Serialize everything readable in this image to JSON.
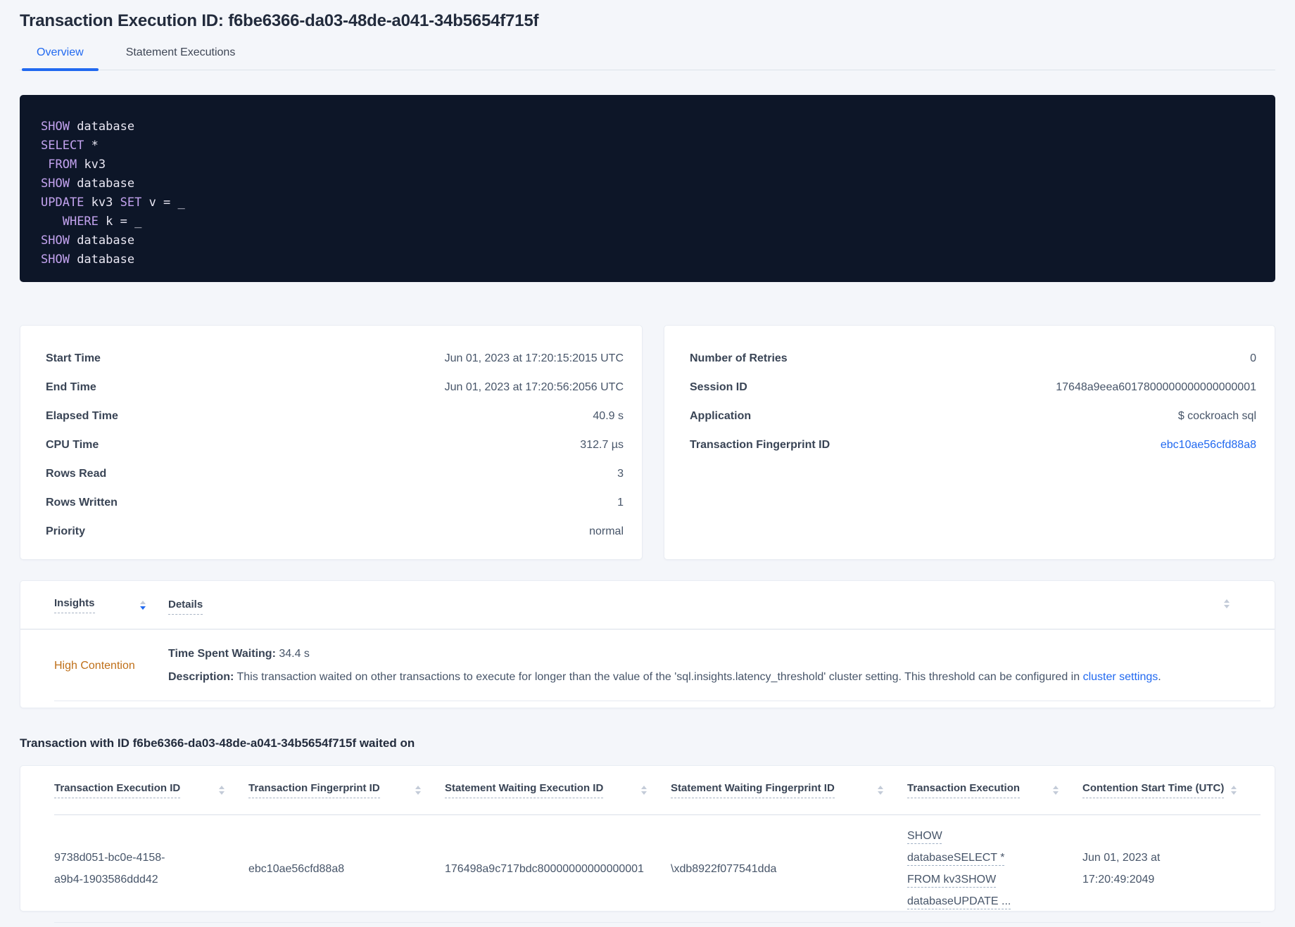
{
  "colors": {
    "accent_blue": "#2169f0",
    "high_contention_orange": "#bf6f18",
    "code_background": "#0d1628",
    "code_keyword": "#c2a2ee",
    "page_background": "#f4f6fa"
  },
  "icons": {
    "sort": "sort-arrows-icon (up/down triangles)"
  },
  "header": {
    "title": "Transaction Execution ID: f6be6366-da03-48de-a041-34b5654f715f",
    "tabs": [
      {
        "label": "Overview",
        "active": true
      },
      {
        "label": "Statement Executions",
        "active": false
      }
    ]
  },
  "sql_box": {
    "lines": [
      {
        "segments": [
          {
            "text": "SHOW",
            "kw": true
          },
          {
            "text": " database",
            "kw": false
          }
        ]
      },
      {
        "segments": [
          {
            "text": "SELECT",
            "kw": true
          },
          {
            "text": " *",
            "kw": false
          }
        ]
      },
      {
        "segments": [
          {
            "text": " ",
            "kw": false
          },
          {
            "text": "FROM",
            "kw": true
          },
          {
            "text": " kv3",
            "kw": false
          }
        ]
      },
      {
        "segments": [
          {
            "text": "SHOW",
            "kw": true
          },
          {
            "text": " database",
            "kw": false
          }
        ]
      },
      {
        "segments": [
          {
            "text": "UPDATE",
            "kw": true
          },
          {
            "text": " kv3 ",
            "kw": false
          },
          {
            "text": "SET",
            "kw": true
          },
          {
            "text": " v = _",
            "kw": false
          }
        ]
      },
      {
        "segments": [
          {
            "text": "   ",
            "kw": false
          },
          {
            "text": "WHERE",
            "kw": true
          },
          {
            "text": " k = _",
            "kw": false
          }
        ]
      },
      {
        "segments": [
          {
            "text": "SHOW",
            "kw": true
          },
          {
            "text": " database",
            "kw": false
          }
        ]
      },
      {
        "segments": [
          {
            "text": "SHOW",
            "kw": true
          },
          {
            "text": " database",
            "kw": false
          }
        ]
      }
    ]
  },
  "details_cards": {
    "left": {
      "rows": [
        {
          "label": "Start Time",
          "value": "Jun 01, 2023 at 17:20:15:2015 UTC"
        },
        {
          "label": "End Time",
          "value": "Jun 01, 2023 at 17:20:56:2056 UTC"
        },
        {
          "label": "Elapsed Time",
          "value": "40.9 s"
        },
        {
          "label": "CPU Time",
          "value": "312.7 µs"
        },
        {
          "label": "Rows Read",
          "value": "3"
        },
        {
          "label": "Rows Written",
          "value": "1"
        },
        {
          "label": "Priority",
          "value": "normal"
        }
      ]
    },
    "right": {
      "rows": [
        {
          "label": "Number of Retries",
          "value": "0"
        },
        {
          "label": "Session ID",
          "value": "17648a9eea6017800000000000000001"
        },
        {
          "label": "Application",
          "value": "$ cockroach sql"
        },
        {
          "label": "Transaction Fingerprint ID",
          "value": "ebc10ae56cfd88a8"
        }
      ]
    }
  },
  "insights_table": {
    "columns": [
      "Insights",
      "Details"
    ],
    "row": {
      "insight": "High Contention",
      "time_spent_waiting_label": "Time Spent Waiting:",
      "time_spent_waiting_value": " 34.4 s",
      "description_label": "Description:",
      "description_text": " This transaction waited on other transactions to execute for longer than the value of the 'sql.insights.latency_threshold' cluster setting. This threshold can be configured in ",
      "description_link": "cluster settings",
      "description_suffix": "."
    }
  },
  "waited_on_section": {
    "heading": "Transaction with ID f6be6366-da03-48de-a041-34b5654f715f waited on",
    "columns": [
      "Transaction Execution ID",
      "Transaction Fingerprint ID",
      "Statement Waiting Execution ID",
      "Statement Waiting Fingerprint ID",
      "Transaction Execution",
      "Contention Start Time (UTC)"
    ],
    "rows": [
      {
        "transaction_execution_id": "9738d051-bc0e-4158-a9b4-1903586ddd42",
        "transaction_fingerprint_id": "ebc10ae56cfd88a8",
        "statement_waiting_execution_id": "176498a9c717bdc80000000000000001",
        "statement_waiting_fingerprint_id": "\\xdb8922f077541dda",
        "transaction_execution": "SHOW databaseSELECT * FROM kv3SHOW databaseUPDATE ...",
        "contention_start_time": "Jun 01, 2023 at 17:20:49:2049"
      }
    ]
  }
}
